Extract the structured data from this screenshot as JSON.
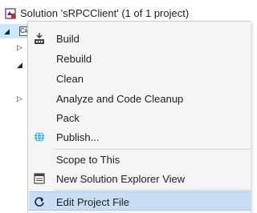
{
  "solution_explorer": {
    "solution_label": "Solution 'sRPCClient' (1 of 1 project)",
    "project_glyph": "C#"
  },
  "context_menu": {
    "items": [
      {
        "label": "Build",
        "icon": "build-icon"
      },
      {
        "label": "Rebuild",
        "icon": ""
      },
      {
        "label": "Clean",
        "icon": ""
      },
      {
        "label": "Analyze and Code Cleanup",
        "icon": "",
        "has_submenu": true
      },
      {
        "label": "Pack",
        "icon": ""
      },
      {
        "label": "Publish...",
        "icon": "globe-icon"
      },
      {
        "label": "Scope to This",
        "icon": ""
      },
      {
        "label": "New Solution Explorer View",
        "icon": "new-window-icon"
      },
      {
        "label": "Edit Project File",
        "icon": "edit-refresh-icon",
        "highlighted": true
      }
    ]
  },
  "colors": {
    "selection": "#cce8ff",
    "menu_background": "#f5f5f5",
    "highlight": "#c9def5",
    "highlight_border": "#a6c8ef"
  }
}
